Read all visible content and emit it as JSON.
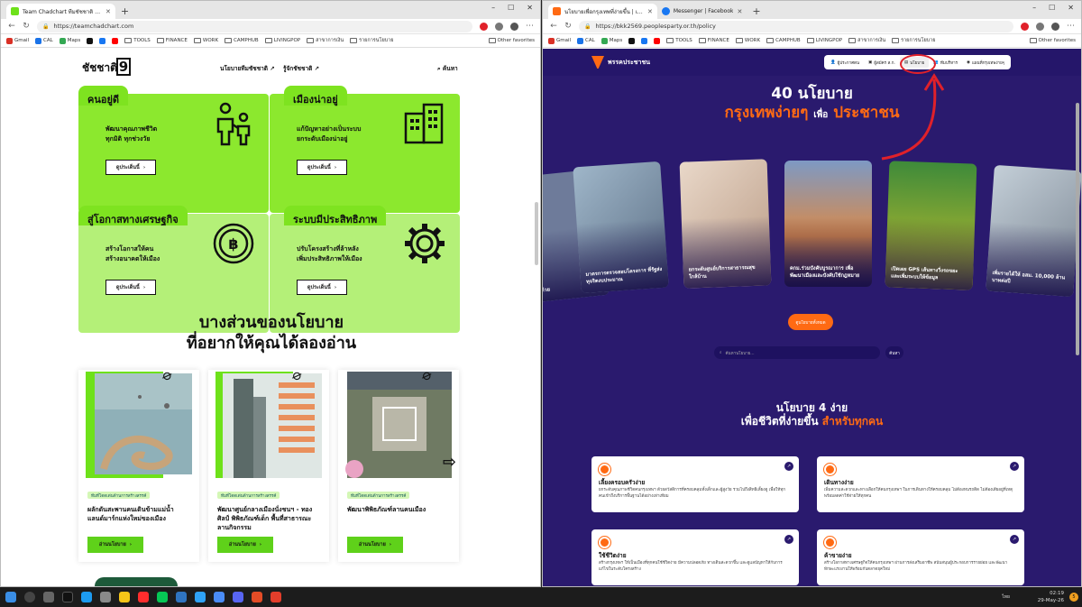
{
  "left_window": {
    "tabs": [
      {
        "title": "Team Chadchart ทีมชัชชาติ ทำงานเพื่อ...",
        "active": true
      }
    ],
    "url": "https://teamchadchart.com",
    "bookmarks": [
      "Gmail",
      "CAL",
      "Maps",
      "TOOLS",
      "FINANCE",
      "WORK",
      "CAMPHUB",
      "LIVINGPOP",
      "สาขาการเงิน",
      "รายการนโยบาย"
    ],
    "other_favorites": "Other favorites",
    "page": {
      "logo_text": "ชัชชาติ",
      "logo_number": "9",
      "nav": [
        "นโยบายทีมชัชชาติ ↗",
        "รู้จักชัชชาติ ↗",
        "ค้นหา"
      ],
      "cards": [
        {
          "title": "คนอยู่ดี",
          "desc": "พัฒนาคุณภาพชีวิต\nทุกมิติ ทุกช่วงวัย",
          "button": "ดูประเด็นนี้",
          "icon": "family-icon"
        },
        {
          "title": "เมืองน่าอยู่",
          "desc": "แก้ปัญหาอย่างเป็นระบบ\nยกระดับเมืองน่าอยู่",
          "button": "ดูประเด็นนี้",
          "icon": "buildings-icon"
        },
        {
          "title": "สู่โอกาสทางเศรษฐกิจ",
          "desc": "สร้างโอกาสให้คน\nสร้างอนาคตให้เมือง",
          "button": "ดูประเด็นนี้",
          "icon": "baht-coin-icon"
        },
        {
          "title": "ระบบมีประสิทธิภาพ",
          "desc": "ปรับโครงสร้างที่ล้าหลัง\nเพิ่มประสิทธิภาพให้เมือง",
          "button": "ดูประเด็นนี้",
          "icon": "gear-icon"
        }
      ],
      "section_title_1": "บางส่วนของนโยบาย",
      "section_title_2": "ที่อยากให้คุณได้ลองอ่าน",
      "policy_cards": [
        {
          "tag": "ทีมที่โดดเด่นด้านการสร้างสรรค์",
          "title": "ผลักดันสะพานคนเดินข้ามแม่น้ำ แลนด์มาร์กแห่งใหม่ของเมือง",
          "button": "อ่านนโยบาย"
        },
        {
          "tag": "ทีมที่โดดเด่นด้านการสร้างสรรค์",
          "title": "พัฒนาศูนย์กลางเมืองนั่งชนฯ - ทองศิลป์ พิพิธภัณฑ์เด็ก พื้นที่สาธารณะ ลานกิจกรรม",
          "button": "อ่านนโยบาย"
        },
        {
          "tag": "ทีมที่โดดเด่นด้านการสร้างสรรค์",
          "title": "พัฒนาพิพิธภัณฑ์ลานคนเมือง",
          "button": "อ่านนโยบาย"
        }
      ]
    }
  },
  "right_window": {
    "tabs": [
      {
        "title": "นโยบายเพื่อกรุงเทพที่ง่ายขึ้น | เพื่อไทย...",
        "active": true
      },
      {
        "title": "Messenger | Facebook",
        "active": false
      }
    ],
    "url": "https://bkk2569.peoplesparty.or.th/policy",
    "bookmarks": [
      "Gmail",
      "CAL",
      "Maps",
      "TOOLS",
      "FINANCE",
      "WORK",
      "CAMPHUB",
      "LIVINGPOP",
      "สาขาการเงิน",
      "รายการนโยบาย"
    ],
    "other_favorites": "Other favorites",
    "page": {
      "logo_text": "พรรคประชาชน",
      "nav": [
        "ผู้ประกาศตน",
        "ผู้สมัคร ส.ก.",
        "นโยบาย",
        "ทีมบริหาร",
        "แผนที่กรุงเทพง่ายๆ"
      ],
      "hero_line1": "40 นโยบาย",
      "hero_line2_orange": "กรุงเทพง่ายๆ",
      "hero_line2_small": "เพื่อ",
      "hero_line2_end": "ประชาชน",
      "carousel": [
        {
          "caption": "...ห้องด้วย"
        },
        {
          "caption": "มาตรการตรวจสอบโครงการ ที่รัฐส่งทุจริตงบประมาณ"
        },
        {
          "caption": "ยกระดับศูนย์บริการสาธารณสุข ใกล้บ้าน"
        },
        {
          "caption": "คกม.ร่วมบังคับบูรณาการ เพื่อพัฒนาเมืองและบังคับใช้กฎหมาย"
        },
        {
          "caption": "เปิดเผย GPS เส้นทางวิ่งรถขยะ และเพิ่มระบบให้ข้อมูล"
        },
        {
          "caption": "เพิ่มรายได้ให้ อสม. 10,000 ล้านบาทต่อปี"
        }
      ],
      "all_policies_button": "ดูนโยบายทั้งหมด",
      "search_placeholder": "ค้นหานโยบาย...",
      "search_button": "ค้นหา",
      "section_line1": "นโยบาย 4 ง่าย",
      "section_line2": "เพื่อชีวิตที่ง่ายขึ้น",
      "section_line2_orange": "สำหรับทุกคน",
      "easy_cards": [
        {
          "title": "เลี้ยงครอบครัวง่าย",
          "desc": "ยกระดับคุณภาพชีวิตคนกรุงเทพฯ ด้วยสวัสดิการที่ครอบคลุมทั้งเด็กและผู้สูงวัย รวมไปถึงสิทธิเลี้ยงดู เพื่อให้ทุกคนเข้าถึงบริการพื้นฐานได้อย่างเท่าเทียม"
        },
        {
          "title": "เดินทางง่าย",
          "desc": "เพิ่มความสะดวกและทางเลือกให้คนกรุงเทพฯ ในการเดินทางให้ครอบคลุม ไม่ต้องทนรถติด ไม่ต้องเสียอยู่ที่เหตุ พร้อมลดค่าใช้จ่ายให้ทุกคน"
        },
        {
          "title": "ใช้ชีวิตง่าย",
          "desc": "สร้างกรุงเทพฯ ให้เป็นเมืองที่ทุกคนใช้ชีวิตง่าย มีความปลอดภัย ทางเดินสะดวกขึ้น และดูแลปัญหาให้กับการแก้ไขในระดับโครงสร้าง"
        },
        {
          "title": "ค้าขายง่าย",
          "desc": "สร้างโอกาสทางเศรษฐกิจให้คนกรุงเทพฯ ผ่านการส่งเสริมอาชีพ สนับสนุนผู้ประกอบการรายย่อย และพัฒนาทักษะแรงงานให้พร้อมกับตลาดยุคใหม่"
        }
      ]
    }
  },
  "taskbar": {
    "time": "02:19",
    "date": "29-May-26",
    "lang": "ไทย",
    "notif_count": "5"
  }
}
